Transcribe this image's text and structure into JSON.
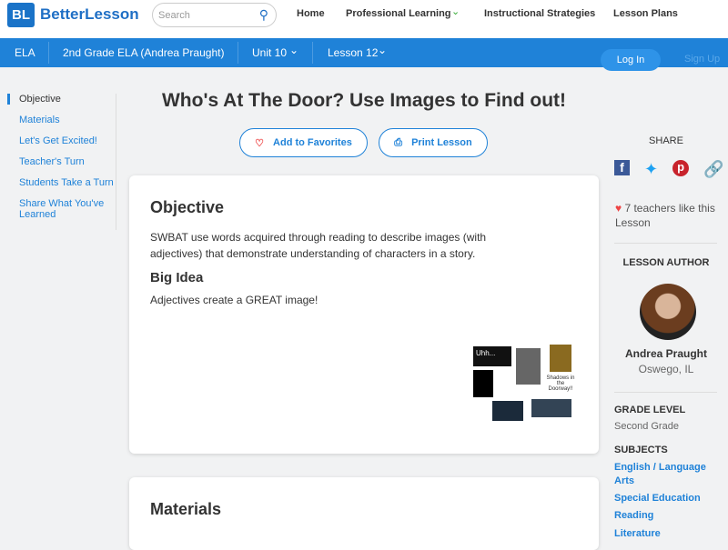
{
  "header": {
    "logo": "BL",
    "brand": "BetterLesson",
    "search_placeholder": "Search",
    "nav": [
      "Home",
      "Professional Learning",
      "Instructional Strategies",
      "Lesson Plans"
    ]
  },
  "breadcrumb": {
    "subject": "ELA",
    "course": "2nd Grade ELA (Andrea Praught)",
    "unit": "Unit 10",
    "lesson": "Lesson 12",
    "login": "Log In",
    "signup": "Sign Up"
  },
  "sidebar": [
    "Objective",
    "Materials",
    "Let's Get Excited!",
    "Teacher's Turn",
    "Students Take a Turn",
    "Share What You've Learned"
  ],
  "title": "Who's At The Door? Use Images to Find out!",
  "actions": {
    "favorite": "Add to Favorites",
    "print": "Print Lesson"
  },
  "objective": {
    "heading": "Objective",
    "text": "SWBAT use words acquired through reading to describe images (with adjectives) that demonstrate understanding of characters in a story.",
    "big_idea_heading": "Big Idea",
    "big_idea": "Adjectives create a GREAT image!",
    "image_text": [
      "Uhh...",
      "Shadows in the Doorway!!"
    ]
  },
  "materials": {
    "heading": "Materials"
  },
  "right": {
    "share": "SHARE",
    "likes": "7 teachers like this Lesson",
    "author_label": "LESSON AUTHOR",
    "author_name": "Andrea Praught",
    "author_location": "Oswego, IL",
    "grade_label": "GRADE LEVEL",
    "grade": "Second Grade",
    "subjects_label": "SUBJECTS",
    "subjects": [
      "English / Language Arts",
      "Special Education",
      "Reading",
      "Literature"
    ]
  }
}
